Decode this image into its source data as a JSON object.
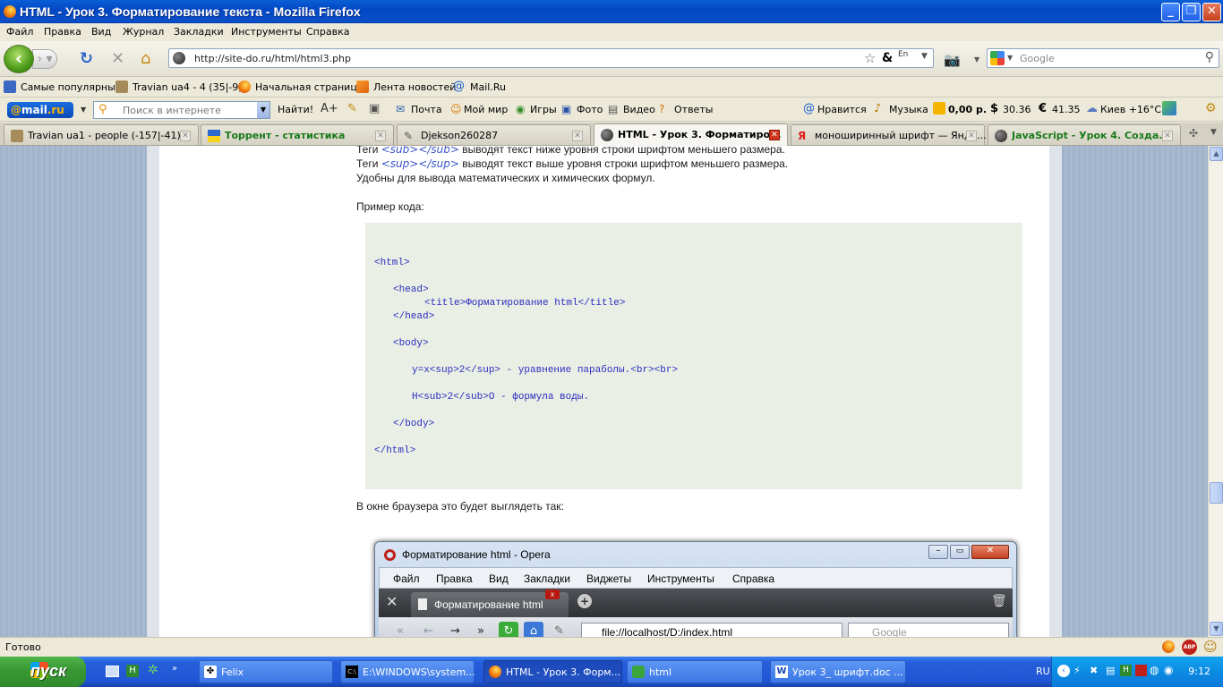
{
  "window": {
    "title": "HTML - Урок 3. Форматирование текста - Mozilla Firefox"
  },
  "menu": [
    "Файл",
    "Правка",
    "Вид",
    "Журнал",
    "Закладки",
    "Инструменты",
    "Справка"
  ],
  "nav": {
    "url": "http://site-do.ru/html/html3.php",
    "search_placeholder": "Google"
  },
  "bookmarks": [
    "Самые популярные",
    "Travian ua4 - 4 (35|-9)",
    "Начальная страница",
    "Лента новостей",
    "Mail.Ru"
  ],
  "mailbar": {
    "logo_at": "@",
    "logo_mail": "mail",
    "logo_dot": ".ru",
    "search_placeholder": "Поиск в интернете",
    "find": "Найти!",
    "items": [
      "Почта",
      "Мой мир",
      "Игры",
      "Фото",
      "Видео",
      "Ответы",
      "Нравится",
      "Музыка",
      "0,00 р.",
      "30.36",
      "41.35",
      "Киев +16°C"
    ]
  },
  "tabs": [
    {
      "label": "Travian ua1 - people (-157|-41)",
      "active": false
    },
    {
      "label": "Торрент - статистика",
      "active": false
    },
    {
      "label": "Djekson260287",
      "active": false
    },
    {
      "label": "HTML - Урок 3. Форматиро...",
      "active": true
    },
    {
      "label": "моноширинный шрифт — Янде...",
      "active": false
    },
    {
      "label": "JavaScript - Урок 4. Созда...",
      "active": false
    }
  ],
  "page": {
    "line1_pre": "Теги ",
    "line1_tag": "<sub></sub>",
    "line1_post": " выводят текст ниже уровня строки шрифтом меньшего размера.",
    "line2_pre": "Теги ",
    "line2_tag": "<sup></sup>",
    "line2_post": " выводят текст выше уровня строки шрифтом меньшего размера.",
    "line3": "Удобны для вывода математических и химических формул.",
    "example_label": "Пример кода:",
    "code": [
      "<html>",
      "<head>",
      "<title>Форматирование html</title>",
      "</head>",
      "<body>",
      "y=x<sup>2</sup> - уравнение параболы.<br><br>",
      "H<sub>2</sub>O - формула воды.",
      "</body>",
      "</html>"
    ],
    "browser_label": "В окне браузера это будет выглядеть так:"
  },
  "opera_screenshot": {
    "title": "Форматирование html - Opera",
    "menu": [
      "Файл",
      "Правка",
      "Вид",
      "Закладки",
      "Виджеты",
      "Инструменты",
      "Справка"
    ],
    "tab": "Форматирование html",
    "address": "file://localhost/D:/index.html",
    "search": "Google"
  },
  "status": "Готово",
  "taskbar": {
    "start": "пуск",
    "buttons": [
      {
        "label": "Felix",
        "active": false
      },
      {
        "label": "E:\\WINDOWS\\system...",
        "active": false
      },
      {
        "label": "HTML - Урок 3. Форм...",
        "active": true
      },
      {
        "label": "html",
        "active": false
      },
      {
        "label": "Урок 3_ шрифт.doc ...",
        "active": false
      }
    ],
    "lang": "RU",
    "clock": "9:12"
  }
}
